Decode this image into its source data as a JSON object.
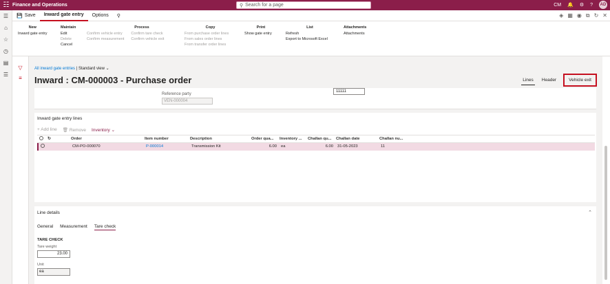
{
  "app": {
    "title": "Finance and Operations",
    "search_placeholder": "Search for a page",
    "company": "CM",
    "user_initials": "AD"
  },
  "actionbar": {
    "save_label": "Save",
    "tab_label": "Inward gate entry",
    "options_label": "Options"
  },
  "ribbon": {
    "groups": [
      {
        "title": "New",
        "items": [
          "Inward gate entry"
        ]
      },
      {
        "title": "Maintain",
        "items": [
          "Edit",
          "Delete",
          "Cancel"
        ]
      },
      {
        "title": "Process",
        "items": [
          "Confirm vehicle entry",
          "Confirm measurement"
        ],
        "items2": [
          "Confirm tare check",
          "Confirm vehicle exit"
        ]
      },
      {
        "title": "Copy",
        "items": [
          "From purchase order lines",
          "From sales order lines",
          "From transfer order lines"
        ]
      },
      {
        "title": "Print",
        "items": [
          "Show gate entry"
        ]
      },
      {
        "title": "List",
        "items": [
          "Refresh",
          "Export to Microsoft Excel"
        ]
      },
      {
        "title": "Attachments",
        "items": [
          "Attachments"
        ]
      }
    ]
  },
  "page": {
    "breadcrumb": "All inward gate entries",
    "view": "Standard view",
    "title": "Inward : CM-000003 - Purchase order",
    "view_tabs": [
      "Lines",
      "Header",
      "Vehicle exit"
    ]
  },
  "header_card": {
    "reference_party_label": "Reference party",
    "reference_party_value": "VEN-000004",
    "field_value": "11111"
  },
  "lines": {
    "title": "Inward gate entry lines",
    "toolbar": {
      "add": "+ Add line",
      "remove": "Remove",
      "inventory": "Inventory"
    },
    "columns": [
      "Order",
      "Item number",
      "Description",
      "Order qua...",
      "Inventory ...",
      "Challan qu...",
      "Challan date",
      "Challan nu..."
    ],
    "rows": [
      {
        "order": "CM-PO-000070",
        "item": "P-000014",
        "description": "Transmission Kit",
        "order_qty": "6.00",
        "unit": "ea",
        "challan_qty": "6.00",
        "challan_date": "31-05-2023",
        "challan_no": "11"
      }
    ]
  },
  "line_details": {
    "title": "Line details",
    "tabs": [
      "General",
      "Measurement",
      "Tare check"
    ],
    "section": "TARE CHECK",
    "tare_weight_label": "Tare weight",
    "tare_weight_value": "23.00",
    "unit_label": "Unit",
    "unit_value": "ea"
  },
  "colors": {
    "brand": "#8b1e4a",
    "highlight": "#c50f1f"
  }
}
